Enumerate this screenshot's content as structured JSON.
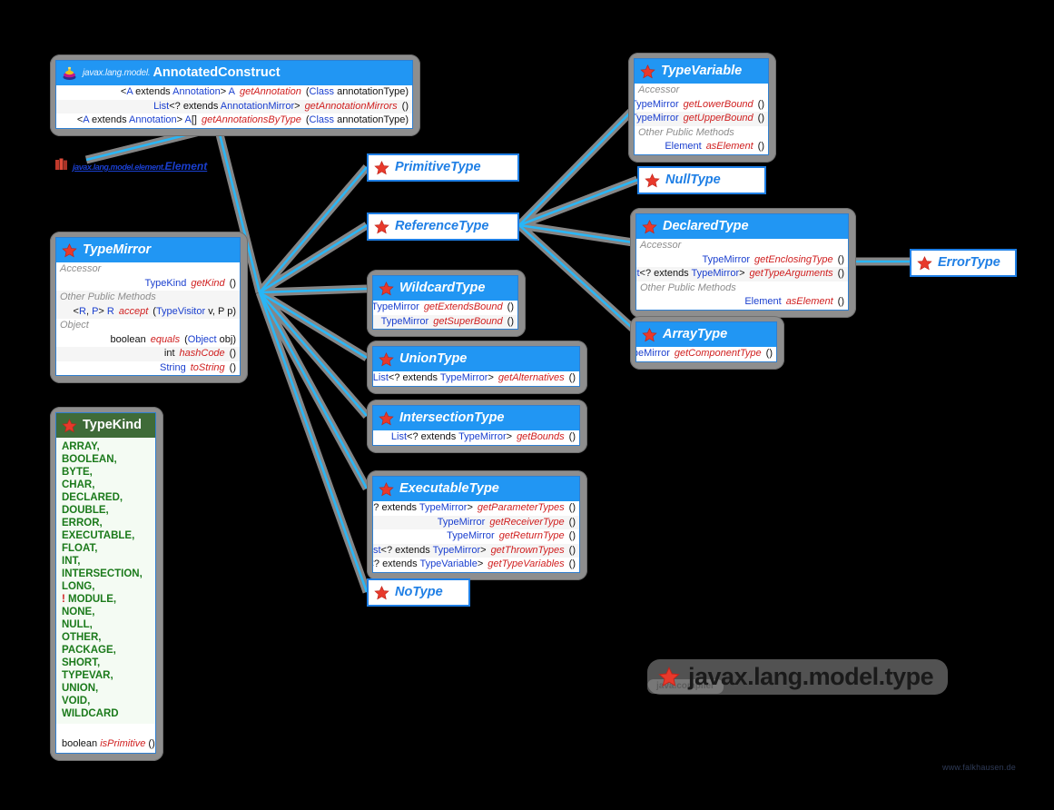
{
  "meta": {
    "package_title": "javax.lang.model.type",
    "package_subtitle": "java.compiler",
    "watermark": "www.falkhausen.de"
  },
  "external_refs": [
    {
      "name": "element-reference",
      "package_prefix": "javax.lang.model.element.",
      "label": "Element",
      "icon": "package-icon"
    }
  ],
  "classes": {
    "annotated_construct": {
      "package_prefix": "javax.lang.model.",
      "name": "AnnotatedConstruct",
      "icon": "annotation-rings-icon",
      "members": [
        {
          "type": "<A extends Annotation> A",
          "method": "getAnnotation",
          "args": "(Class <A> annotationType)"
        },
        {
          "type": "List<? extends AnnotationMirror>",
          "method": "getAnnotationMirrors",
          "args": "()"
        },
        {
          "type": "<A extends Annotation> A[]",
          "method": "getAnnotationsByType",
          "args": "(Class<A> annotationType)"
        }
      ]
    },
    "type_mirror": {
      "name": "TypeMirror",
      "icon": "interface-star-icon",
      "sections": [
        {
          "label": "Accessor",
          "members": [
            {
              "type": "TypeKind",
              "method": "getKind",
              "args": "()"
            }
          ]
        },
        {
          "label": "Other Public Methods",
          "members": [
            {
              "type": "<R, P> R",
              "method": "accept",
              "args": "(TypeVisitor <R, P> v, P p)"
            }
          ]
        },
        {
          "label": "Object",
          "members": [
            {
              "type": "boolean",
              "method": "equals",
              "args": "(Object obj)"
            },
            {
              "type": "int",
              "method": "hashCode",
              "args": "()"
            },
            {
              "type": "String",
              "method": "toString",
              "args": "()"
            }
          ]
        }
      ]
    },
    "type_kind": {
      "name": "TypeKind",
      "icon": "enum-star-icon",
      "constants": [
        "ARRAY,",
        "BOOLEAN,",
        "BYTE,",
        "CHAR,",
        "DECLARED,",
        "DOUBLE,",
        "ERROR,",
        "EXECUTABLE,",
        "FLOAT,",
        "INT,",
        "INTERSECTION,",
        "LONG,",
        "! MODULE,",
        "NONE,",
        "NULL,",
        "OTHER,",
        "PACKAGE,",
        "SHORT,",
        "TYPEVAR,",
        "UNION,",
        "VOID,",
        "WILDCARD"
      ],
      "footer": {
        "type": "boolean",
        "method": "isPrimitive",
        "args": "()"
      }
    },
    "primitive_type": {
      "name": "PrimitiveType",
      "icon": "interface-star-icon",
      "members": []
    },
    "reference_type": {
      "name": "ReferenceType",
      "icon": "interface-star-icon",
      "members": []
    },
    "null_type": {
      "name": "NullType",
      "icon": "interface-star-icon",
      "members": []
    },
    "no_type": {
      "name": "NoType",
      "icon": "interface-star-icon",
      "members": []
    },
    "error_type": {
      "name": "ErrorType",
      "icon": "interface-star-icon",
      "members": []
    },
    "wildcard_type": {
      "name": "WildcardType",
      "icon": "interface-star-icon",
      "members": [
        {
          "type": "TypeMirror",
          "method": "getExtendsBound",
          "args": "()"
        },
        {
          "type": "TypeMirror",
          "method": "getSuperBound",
          "args": "()"
        }
      ]
    },
    "union_type": {
      "name": "UnionType",
      "icon": "interface-star-icon",
      "members": [
        {
          "type": "List<? extends TypeMirror>",
          "method": "getAlternatives",
          "args": "()"
        }
      ]
    },
    "intersection_type": {
      "name": "IntersectionType",
      "icon": "interface-star-icon",
      "members": [
        {
          "type": "List<? extends TypeMirror>",
          "method": "getBounds",
          "args": "()"
        }
      ]
    },
    "executable_type": {
      "name": "ExecutableType",
      "icon": "interface-star-icon",
      "members": [
        {
          "type": "List<? extends TypeMirror>",
          "method": "getParameterTypes",
          "args": "()"
        },
        {
          "type": "TypeMirror",
          "method": "getReceiverType",
          "args": "()"
        },
        {
          "type": "TypeMirror",
          "method": "getReturnType",
          "args": "()"
        },
        {
          "type": "List<? extends TypeMirror>",
          "method": "getThrownTypes",
          "args": "()"
        },
        {
          "type": "List<? extends TypeVariable>",
          "method": "getTypeVariables",
          "args": "()"
        }
      ]
    },
    "type_variable": {
      "name": "TypeVariable",
      "icon": "interface-star-icon",
      "sections": [
        {
          "label": "Accessor",
          "members": [
            {
              "type": "TypeMirror",
              "method": "getLowerBound",
              "args": "()"
            },
            {
              "type": "TypeMirror",
              "method": "getUpperBound",
              "args": "()"
            }
          ]
        },
        {
          "label": "Other Public Methods",
          "members": [
            {
              "type": "Element",
              "method": "asElement",
              "args": "()"
            }
          ]
        }
      ]
    },
    "declared_type": {
      "name": "DeclaredType",
      "icon": "interface-star-icon",
      "sections": [
        {
          "label": "Accessor",
          "members": [
            {
              "type": "TypeMirror",
              "method": "getEnclosingType",
              "args": "()"
            },
            {
              "type": "List<? extends TypeMirror>",
              "method": "getTypeArguments",
              "args": "()"
            }
          ]
        },
        {
          "label": "Other Public Methods",
          "members": [
            {
              "type": "Element",
              "method": "asElement",
              "args": "()"
            }
          ]
        }
      ]
    },
    "array_type": {
      "name": "ArrayType",
      "icon": "interface-star-icon",
      "members": [
        {
          "type": "TypeMirror",
          "method": "getComponentType",
          "args": "()"
        }
      ]
    }
  },
  "colors": {
    "header_blue": "#2196f3",
    "header_green": "#3f6b38",
    "link_blue": "#29b6f6",
    "link_shadow": "#8e8e8e",
    "type_text": "#1a3fcf",
    "method_text": "#d02020",
    "enum_text": "#1b7a1b",
    "background": "#000000"
  }
}
